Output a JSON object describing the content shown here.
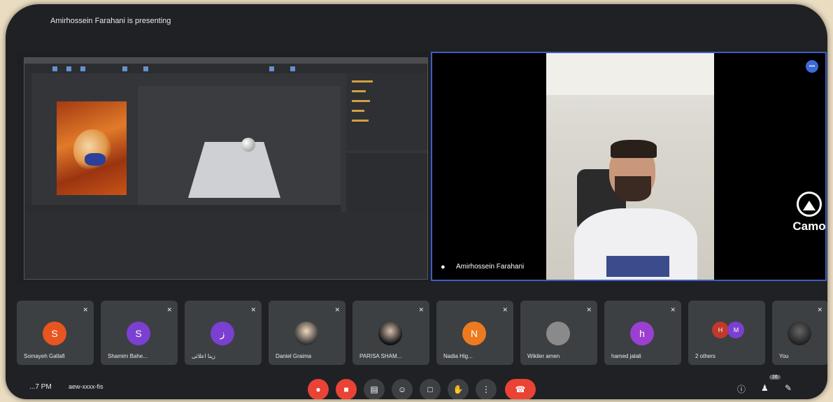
{
  "presenting_text": "Amirhossein Farahani is presenting",
  "main_speaker": {
    "name": "Amirhossein Farahani",
    "overlay_brand": "Camo"
  },
  "participants": [
    {
      "name": "Somayeh Gallafi",
      "initial": "S",
      "color": "#e8551f"
    },
    {
      "name": "Shamim Bahe...",
      "initial": "S",
      "color": "#7b3fd1"
    },
    {
      "name": "زینا اعلائی",
      "initial": "ز",
      "color": "#7b3fd1"
    },
    {
      "name": "Daniel Graima",
      "initial": "",
      "color": "#eaeaea"
    },
    {
      "name": "PARISA SHAM...",
      "initial": "",
      "color": "#111111"
    },
    {
      "name": "Nadia Hig...",
      "initial": "N",
      "color": "#ee7a1d"
    },
    {
      "name": "Wikiler amen",
      "initial": "",
      "color": "#777777"
    },
    {
      "name": "hamed jalali",
      "initial": "h",
      "color": "#9b3fd1"
    },
    {
      "name": "2 others",
      "initial": "",
      "color": "#7b3fd1"
    },
    {
      "name": "You",
      "initial": "",
      "color": "#333333"
    }
  ],
  "others_initials": [
    "H",
    "M"
  ],
  "bottom": {
    "time": "...7 PM",
    "meeting_code": "aew-xxxx-fis",
    "people_badge": "16"
  },
  "controls": [
    "mic-off",
    "camera-off",
    "captions",
    "emoji",
    "present",
    "raise-hand",
    "more",
    "end-call"
  ]
}
